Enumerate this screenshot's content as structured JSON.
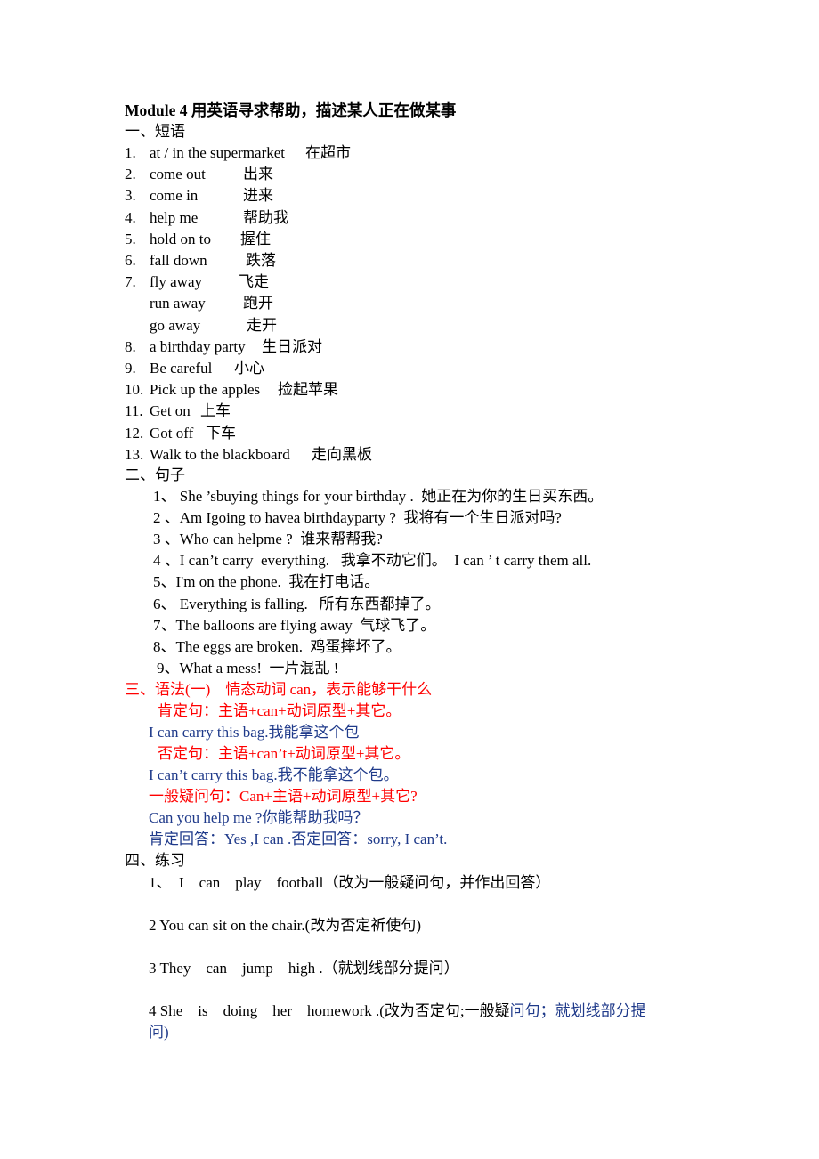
{
  "title": "Module 4 用英语寻求帮助，描述某人正在做某事",
  "sections": {
    "phrases": {
      "heading": "一、短语",
      "items": [
        {
          "num": "1.",
          "en": "at / in the supermarket",
          "cn": "在超市"
        },
        {
          "num": "2.",
          "en": "come out",
          "cn": "出来"
        },
        {
          "num": "3.",
          "en": "come in",
          "cn": "进来"
        },
        {
          "num": "4.",
          "en": "help me",
          "cn": "帮助我"
        },
        {
          "num": "5.",
          "en": "hold on to",
          "cn": "握住"
        },
        {
          "num": "6.",
          "en": "fall down",
          "cn": "跌落"
        },
        {
          "num": "7.",
          "en": "fly away",
          "cn": "飞走"
        },
        {
          "num": "",
          "en": "run away",
          "cn": "跑开"
        },
        {
          "num": "",
          "en": "go away",
          "cn": "走开"
        },
        {
          "num": "8.",
          "en": "a birthday party",
          "cn": "生日派对"
        },
        {
          "num": "9.",
          "en": "Be careful",
          "cn": "小心"
        },
        {
          "num": "10.",
          "en": "Pick up the apples",
          "cn": "捡起苹果"
        },
        {
          "num": "11.",
          "en": "Get on",
          "cn": "上车"
        },
        {
          "num": "12.",
          "en": "Got off",
          "cn": "下车"
        },
        {
          "num": "13.",
          "en": "Walk to the blackboard",
          "cn": "走向黑板"
        }
      ]
    },
    "sentences": {
      "heading": "二、句子",
      "items": [
        "1、 She ’sbuying things for your birthday .  她正在为你的生日买东西。",
        "2 、Am Igoing to havea birthdayparty ?  我将有一个生日派对吗?",
        "3 、Who can helpme ?  谁来帮帮我?",
        "4 、I can’t carry  everything.   我拿不动它们。  I can ’ t carry them all.",
        "5、I'm on the phone.  我在打电话。",
        "6、 Everything is falling.   所有东西都掉了。",
        "7、The balloons are flying away  气球飞了。",
        "8、The eggs are broken.  鸡蛋摔坏了。",
        "9、What a mess!  一片混乱 !"
      ]
    },
    "grammar": {
      "heading": "三、语法(一)    情态动词 can，表示能够干什么",
      "affirmative_rule": "肯定句：主语+can+动词原型+其它。",
      "affirmative_example": "I can carry this bag.我能拿这个包",
      "negative_rule": "否定句：主语+can’t+动词原型+其它。",
      "negative_example": "I can’t carry this bag.我不能拿这个包。",
      "question_rule": "一般疑问句：Can+主语+动词原型+其它?",
      "question_example": "Can you help me ?你能帮助我吗？",
      "answers": "肯定回答：Yes ,I can .否定回答：sorry, I can’t."
    },
    "exercises": {
      "heading": "四、练习",
      "items": [
        "1、  I    can    play    football（改为一般疑问句，并作出回答）",
        "2 You can sit on the chair.(改为否定祈使句)",
        "3 They    can    jump    high .（就划线部分提问）"
      ],
      "item4_black": "4 She    is    doing    her    homework .(改为否定句;一般疑",
      "item4_blue": "问句；就划线部分提",
      "item4_cont": "问)"
    }
  },
  "colors": {
    "text": "#000000",
    "red": "#ff0000",
    "blue": "#1f3a8a"
  }
}
